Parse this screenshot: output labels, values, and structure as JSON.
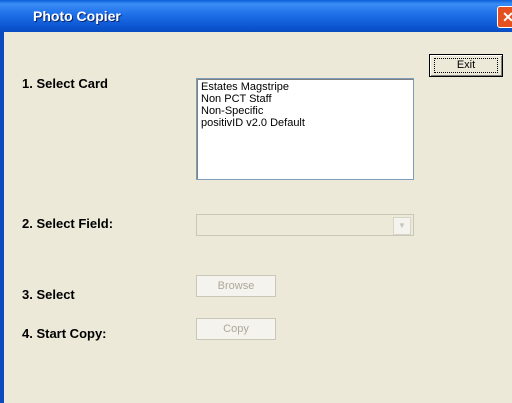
{
  "window": {
    "title": "Photo Copier",
    "close_icon": "close-icon"
  },
  "labels": {
    "select_card": "1. Select Card",
    "select_field": "2. Select Field:",
    "select": "3. Select",
    "start_copy": "4. Start Copy:"
  },
  "exit_label": "Exit",
  "cards": [
    "Estates Magstripe",
    "Non PCT Staff",
    "Non-Specific",
    "positivID v2.0 Default"
  ],
  "field_select": {
    "value": ""
  },
  "browse_label": "Browse",
  "copy_label": "Copy"
}
